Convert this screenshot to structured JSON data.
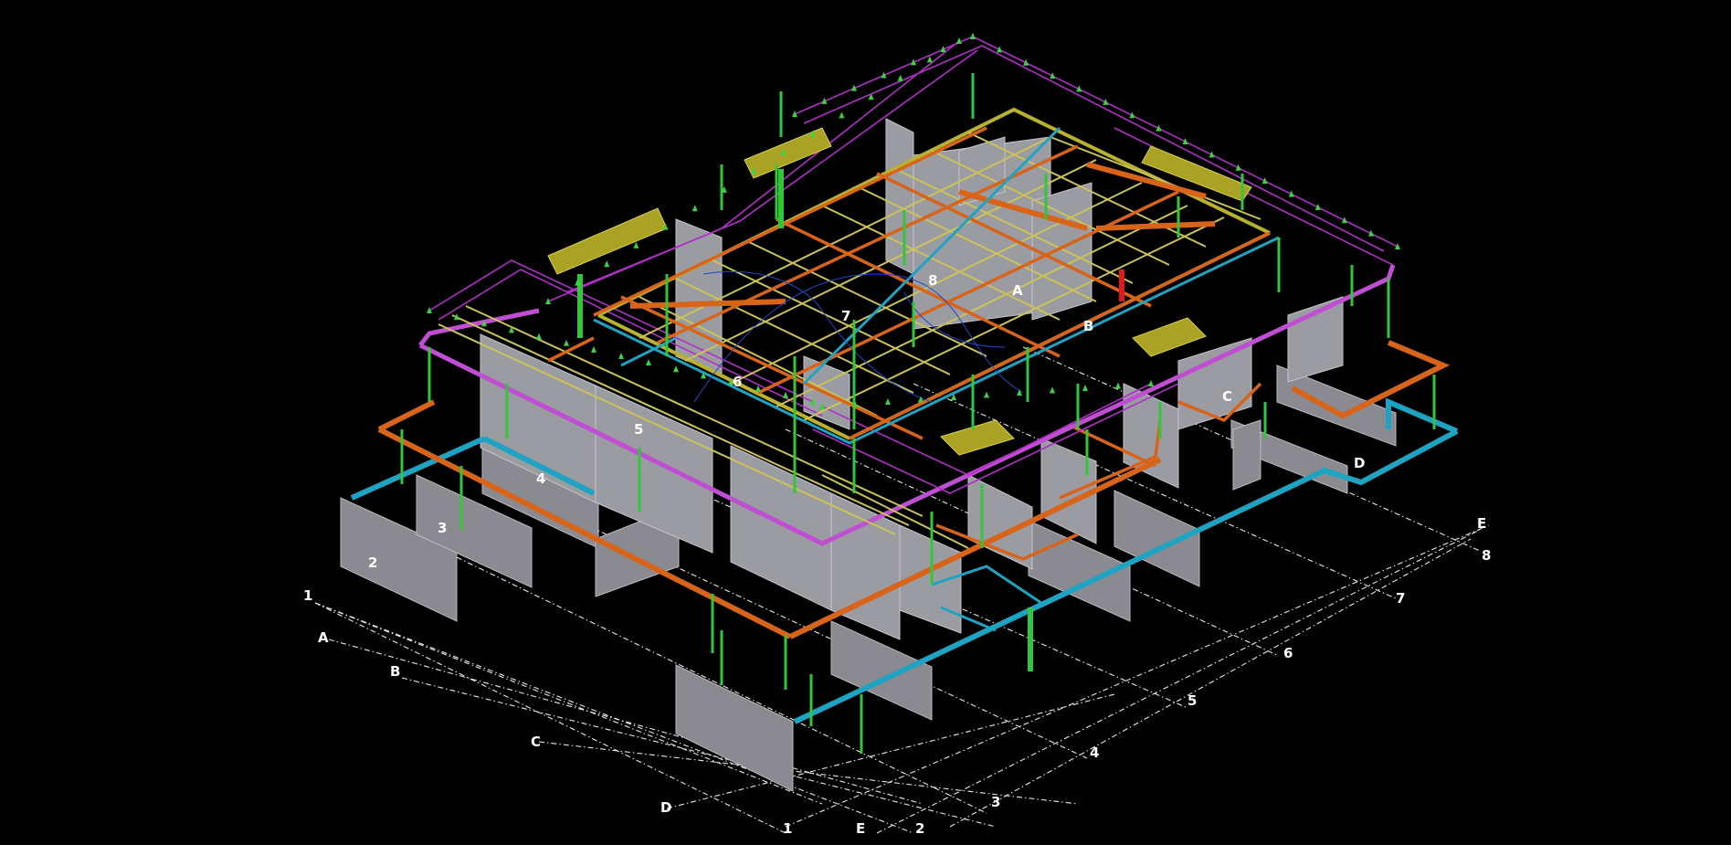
{
  "grid_labels": {
    "front_numbers": [
      "1",
      "2",
      "3",
      "4",
      "5",
      "6",
      "7",
      "8"
    ],
    "front_letters": [
      "A",
      "B",
      "C",
      "D",
      "E"
    ],
    "back_numbers": [
      "1",
      "8"
    ],
    "back_letters": [
      "A",
      "E"
    ],
    "upper_numbers": [
      "2",
      "3",
      "4",
      "5",
      "6",
      "7",
      "8"
    ],
    "upper_letters": [
      "A",
      "B",
      "C",
      "D"
    ]
  },
  "colors": {
    "background": "#000000",
    "wall": "#8a8a90",
    "orange_pipe": "#d8641a",
    "cyan_pipe": "#1fa3c2",
    "magenta_pipe": "#c04ed3",
    "yellow_beam": "#b8b22e",
    "green_column": "#34c53a",
    "grid_line": "#e8e8e8"
  }
}
